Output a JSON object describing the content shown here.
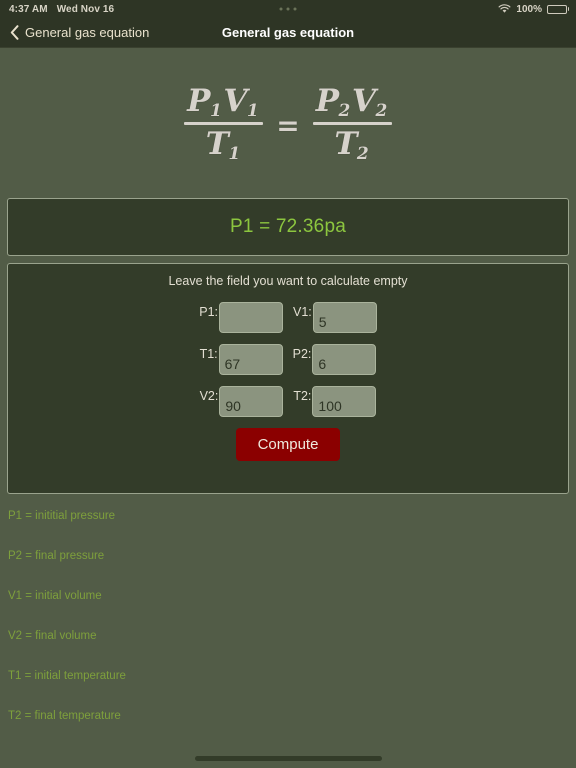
{
  "status_bar": {
    "time": "4:37 AM",
    "date": "Wed Nov 16",
    "battery_percent": "100%",
    "wifi_icon": "wifi-icon",
    "battery_icon": "battery-icon",
    "multitask_dots": "multitask-dots-icon"
  },
  "nav": {
    "back_label": "General gas equation",
    "back_icon": "chevron-left-icon",
    "title": "General gas equation"
  },
  "equation": {
    "left": {
      "num_p": "P",
      "num_p_sub": "1",
      "num_v": "V",
      "num_v_sub": "1",
      "den_t": "T",
      "den_t_sub": "1"
    },
    "operator": "=",
    "right": {
      "num_p": "P",
      "num_p_sub": "2",
      "num_v": "V",
      "num_v_sub": "2",
      "den_t": "T",
      "den_t_sub": "2"
    }
  },
  "result": {
    "text": "P1 = 72.36pa",
    "color": "#8cc63f"
  },
  "form": {
    "hint": "Leave the field you want to calculate empty",
    "fields": [
      {
        "label": "P1:",
        "value": "",
        "placeholder": ""
      },
      {
        "label": "V1:",
        "value": "5",
        "placeholder": ""
      },
      {
        "label": "T1:",
        "value": "67",
        "placeholder": ""
      },
      {
        "label": "P2:",
        "value": "6",
        "placeholder": ""
      },
      {
        "label": "V2:",
        "value": "90",
        "placeholder": ""
      },
      {
        "label": "T2:",
        "value": "100",
        "placeholder": ""
      }
    ],
    "compute_label": "Compute",
    "compute_color": "#8b0000"
  },
  "legend": {
    "items": [
      "P1 = inititial pressure",
      "P2 = final pressure",
      "V1 = initial volume",
      "V2 = final volume",
      "T1 = initial temperature",
      "T2 = final temperature"
    ],
    "color": "#7ea03c"
  },
  "theme": {
    "page_bg": "#525c47",
    "panel_bg": "#333c29",
    "bar_bg": "#2e3525",
    "input_bg": "#8b947f",
    "border": "#9aa38d",
    "text": "#e3dfd2"
  }
}
